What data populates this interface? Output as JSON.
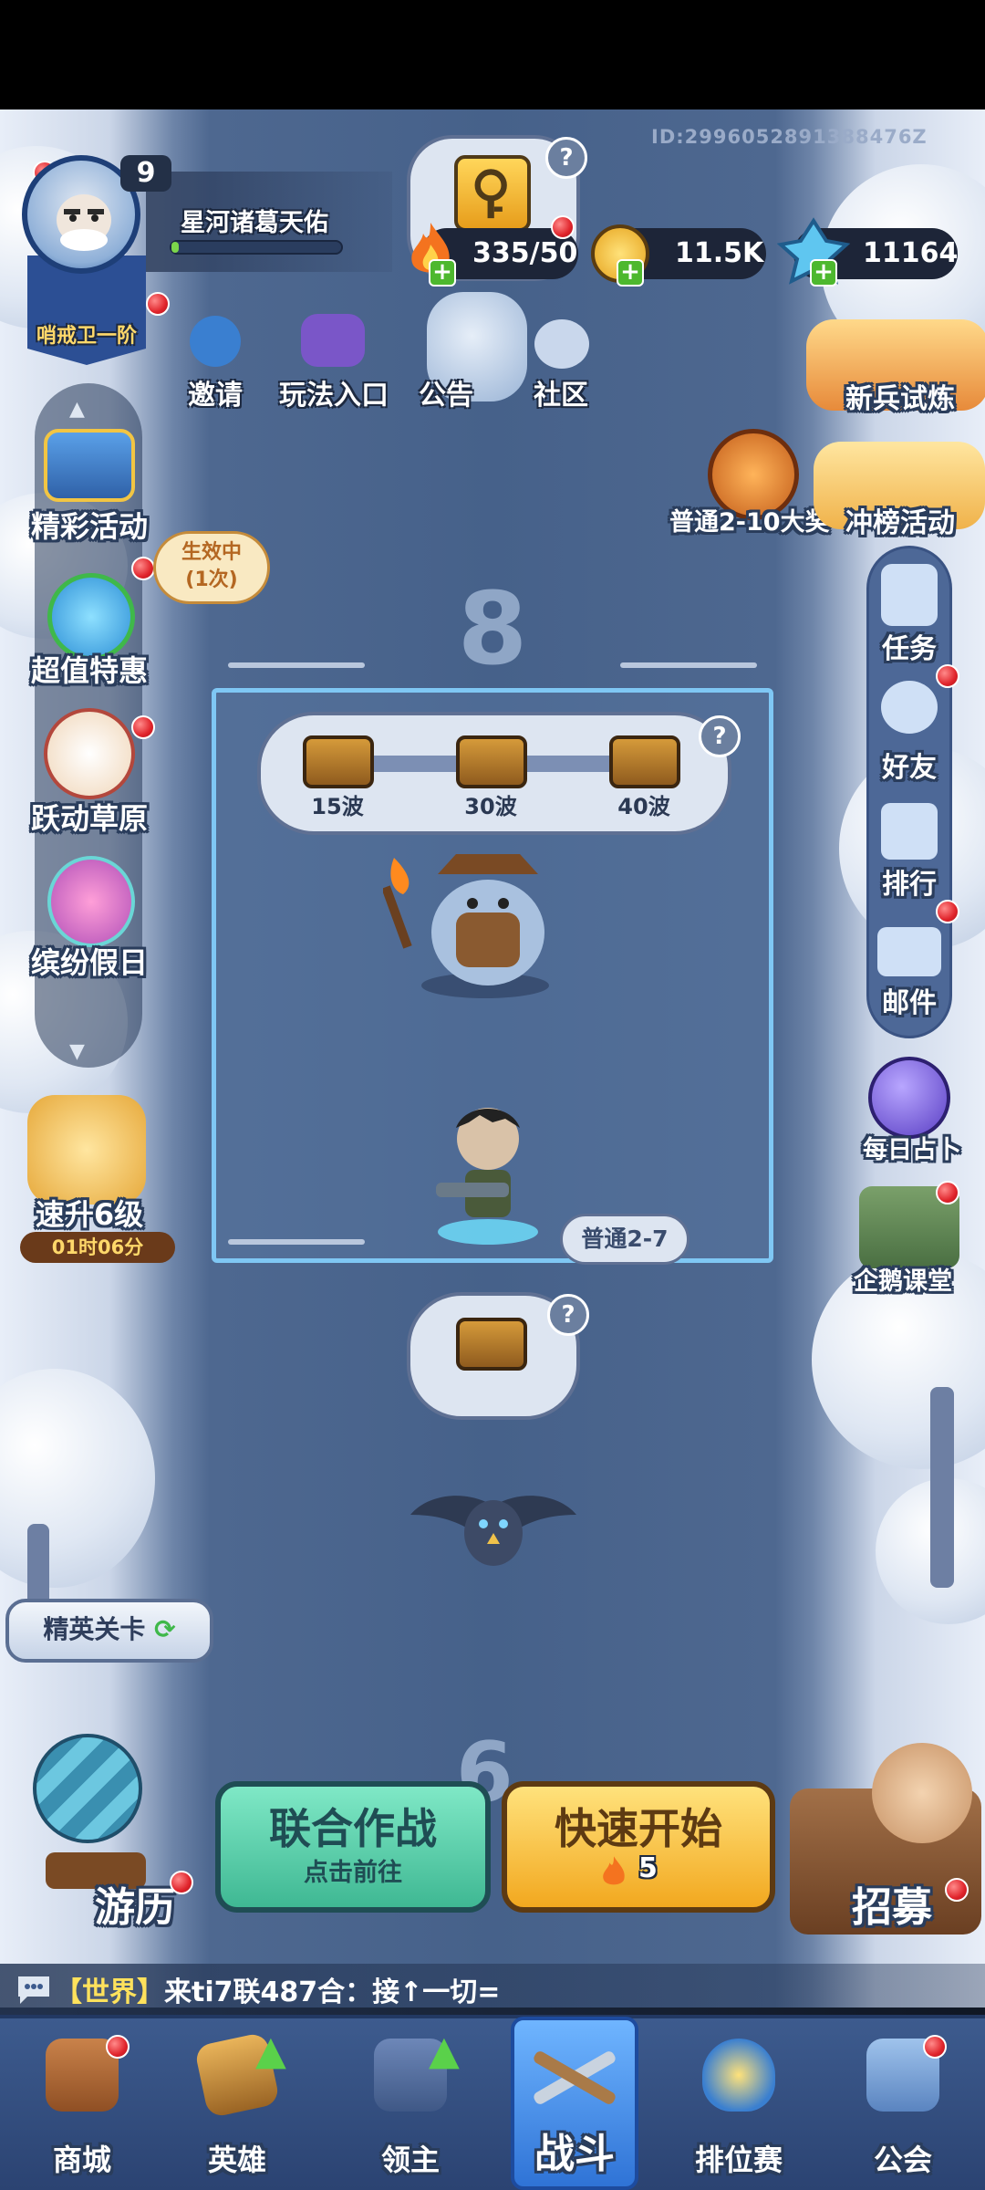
{
  "header": {
    "player_name": "星河诸葛天佑",
    "level": "9",
    "rank_label": "哨戒卫一阶",
    "player_id": "ID:2996052891388476Z"
  },
  "resources": {
    "stamina": "335/50",
    "gold": "11.5K",
    "crystal": "11164"
  },
  "top_menu": [
    {
      "label": "邀请",
      "icon": "penguin-icon"
    },
    {
      "label": "玩法入口",
      "icon": "gamepad-icon"
    },
    {
      "label": "公告",
      "icon": "announcement-icon"
    },
    {
      "label": "社区",
      "icon": "community-icon"
    }
  ],
  "left_menu": {
    "events": "精彩活动",
    "deals": "超值特惠",
    "deals_effect_line1": "生效中",
    "deals_effect_line2": "(1次)",
    "grassland": "跃动草原",
    "holiday": "缤纷假日",
    "quick_level": "速升6级",
    "quick_level_timer": "01时06分"
  },
  "right_menu": {
    "rookie_trial": "新兵试炼",
    "rookie_trial_highlight": "试",
    "rank_event": "冲榜活动",
    "stage_event": "普通2-10大奖",
    "tasks": "任务",
    "friends": "好友",
    "ranking": "排行",
    "mail": "邮件",
    "daily_divination": "每日占卜",
    "penguin_class": "企鹅课堂"
  },
  "battle": {
    "stage_number": "8",
    "next_stage_number": "6",
    "rewards": [
      "15波",
      "30波",
      "40波"
    ],
    "current_stage": "普通2-7",
    "elite_stages": "精英关卡"
  },
  "actions": {
    "coop_title": "联合作战",
    "coop_subtitle": "点击前往",
    "quick_title": "快速开始",
    "quick_cost": "5",
    "travel": "游历",
    "recruit": "招募"
  },
  "chat": {
    "channel": "【世界】",
    "message": "来ti7联487合：接↑一切="
  },
  "nav": [
    {
      "label": "商城",
      "icon": "shop-icon"
    },
    {
      "label": "英雄",
      "icon": "hero-card-icon"
    },
    {
      "label": "领主",
      "icon": "lord-banner-icon"
    },
    {
      "label": "战斗",
      "icon": "crossed-guns-icon"
    },
    {
      "label": "排位赛",
      "icon": "rank-shield-icon"
    },
    {
      "label": "公会",
      "icon": "guild-castle-icon"
    }
  ],
  "colors": {
    "accent_green": "#3fb893",
    "accent_gold": "#f2a81f",
    "zone_border": "#7fc7f4",
    "nav_active": "#2f73d6"
  }
}
